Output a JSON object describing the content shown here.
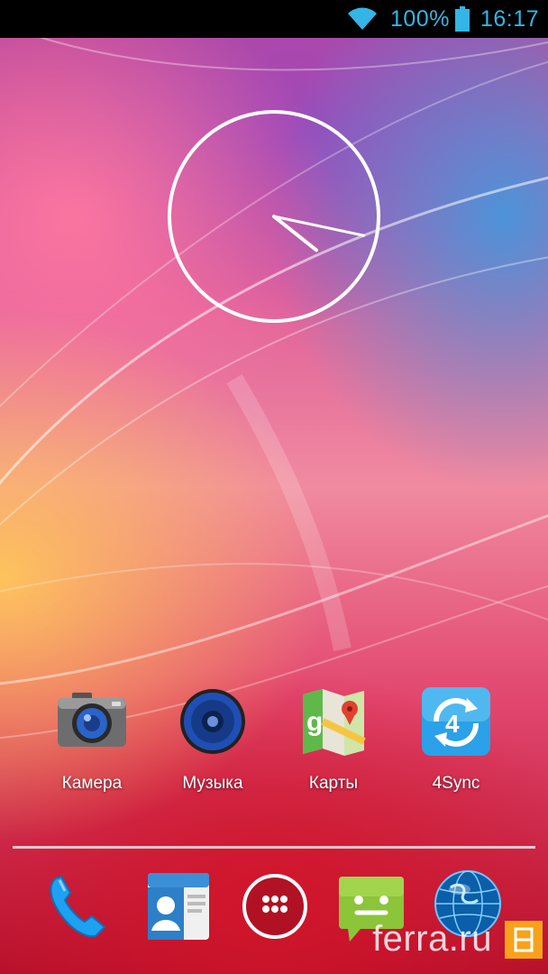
{
  "status_bar": {
    "battery_text": "100%",
    "time": "16:17",
    "icon_color": "#33b5e5",
    "wifi_icon": "wifi-icon",
    "battery_icon": "battery-full-icon"
  },
  "clock_widget": {
    "type": "analog-clock",
    "hour": 16,
    "minute": 17
  },
  "apps": [
    {
      "label": "Камера",
      "icon": "camera-icon"
    },
    {
      "label": "Музыка",
      "icon": "music-speaker-icon"
    },
    {
      "label": "Карты",
      "icon": "maps-icon"
    },
    {
      "label": "4Sync",
      "icon": "4sync-icon"
    }
  ],
  "dock": [
    {
      "icon": "phone-icon"
    },
    {
      "icon": "contacts-icon"
    },
    {
      "icon": "all-apps-icon"
    },
    {
      "icon": "messaging-icon"
    },
    {
      "icon": "browser-globe-icon"
    }
  ],
  "watermark": {
    "text": "ferra.ru",
    "color": "#f6a21a"
  }
}
